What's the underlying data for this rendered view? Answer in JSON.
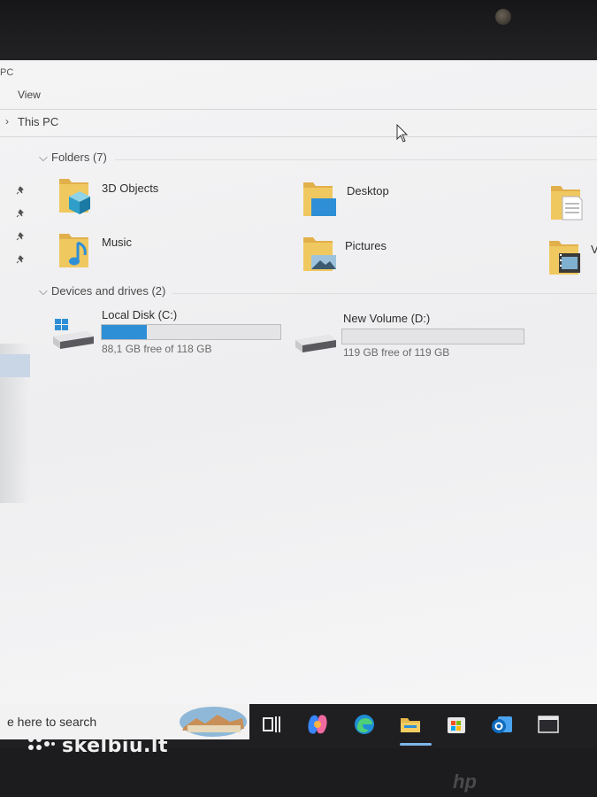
{
  "window": {
    "title_fragment": "PC",
    "menu": {
      "view_label": "View"
    },
    "breadcrumb": {
      "location": "This PC"
    }
  },
  "sections": {
    "folders": {
      "header": "Folders (7)",
      "items": [
        {
          "label": "3D Objects",
          "icon": "3d-objects-folder-icon"
        },
        {
          "label": "Desktop",
          "icon": "desktop-folder-icon"
        },
        {
          "label": "",
          "icon": "documents-folder-icon"
        },
        {
          "label": "Music",
          "icon": "music-folder-icon"
        },
        {
          "label": "Pictures",
          "icon": "pictures-folder-icon"
        },
        {
          "label": "V",
          "icon": "videos-folder-icon"
        }
      ]
    },
    "devices": {
      "header": "Devices and drives (2)",
      "drives": [
        {
          "label": "Local Disk (C:)",
          "free_text": "88,1 GB free of 118 GB",
          "used_fraction": 0.25,
          "icon": "windows-drive-icon"
        },
        {
          "label": "New Volume (D:)",
          "free_text": "119 GB free of 119 GB",
          "used_fraction": 0.0,
          "icon": "hard-drive-icon"
        }
      ]
    }
  },
  "taskbar": {
    "search_placeholder": "e here to search",
    "icons": [
      "task-view-icon",
      "copilot-icon",
      "edge-icon",
      "file-explorer-icon",
      "microsoft-store-icon",
      "outlook-icon",
      "terminal-icon"
    ],
    "active": "file-explorer-icon"
  },
  "overlay": {
    "watermark": "skelbiu.lt",
    "bezel_logo": "hp"
  },
  "colors": {
    "accent": "#2f8fd6",
    "folder_yellow": "#e8b84a",
    "taskbar": "#1f1f22"
  }
}
